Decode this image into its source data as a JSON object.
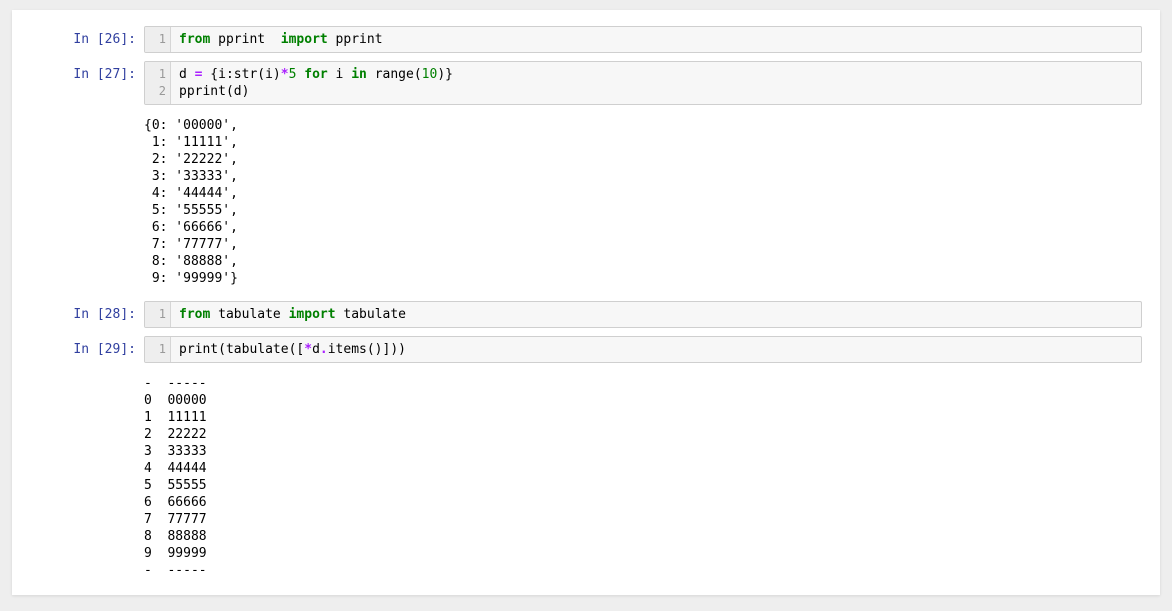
{
  "cells": {
    "c26": {
      "prompt": "In [26]:",
      "gutter": "1",
      "code_parts": {
        "p1": "from",
        "p2": " pprint  ",
        "p3": "import",
        "p4": " pprint"
      }
    },
    "c27": {
      "prompt": "In [27]:",
      "gutter": "1\n2",
      "code_parts": {
        "p1": "d ",
        "p2": "=",
        "p3": " {i:str(i)",
        "p4": "*",
        "p5": "5",
        "p6": " ",
        "p7": "for",
        "p8": " i ",
        "p9": "in",
        "p10": " range(",
        "p11": "10",
        "p12": ")}\npprint(d)"
      },
      "output": "{0: '00000',\n 1: '11111',\n 2: '22222',\n 3: '33333',\n 4: '44444',\n 5: '55555',\n 6: '66666',\n 7: '77777',\n 8: '88888',\n 9: '99999'}"
    },
    "c28": {
      "prompt": "In [28]:",
      "gutter": "1",
      "code_parts": {
        "p1": "from",
        "p2": " tabulate ",
        "p3": "import",
        "p4": " tabulate"
      }
    },
    "c29": {
      "prompt": "In [29]:",
      "gutter": "1",
      "code_parts": {
        "p1": "print(tabulate([",
        "p2": "*",
        "p3": "d",
        "p4": ".",
        "p5": "items()]))"
      },
      "output": "-  -----\n0  00000\n1  11111\n2  22222\n3  33333\n4  44444\n5  55555\n6  66666\n7  77777\n8  88888\n9  99999\n-  -----"
    }
  }
}
